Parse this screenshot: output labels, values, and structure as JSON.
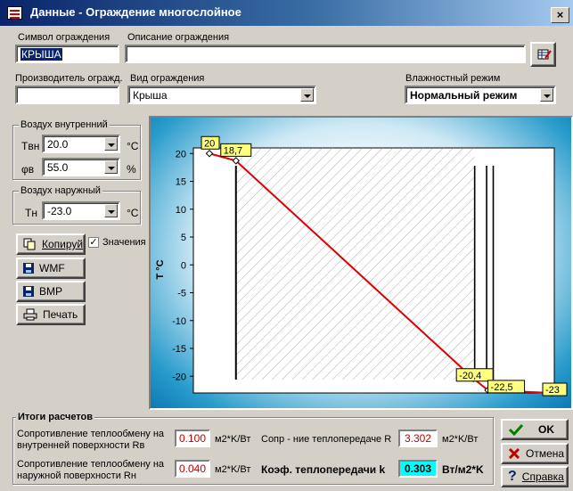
{
  "window": {
    "title": "Данные - Ограждение многослойное",
    "close_label": "×"
  },
  "form": {
    "symbol_label": "Символ ограждения",
    "symbol_value": "КРЫША",
    "description_label": "Описание ограждения",
    "description_value": "",
    "producer_label": "Производитель огражд.",
    "producer_value": "",
    "type_label": "Вид ограждения",
    "type_value": "Крыша",
    "humidity_label": "Влажностный режим",
    "humidity_value": "Нормальный режим"
  },
  "inner_air": {
    "title": "Воздух внутренний",
    "t_label": "Tвн",
    "t_value": "20.0",
    "t_unit": "°C",
    "phi_label": "φв",
    "phi_value": "55.0",
    "phi_unit": "%"
  },
  "outer_air": {
    "title": "Воздух наружный",
    "t_label": "Tн",
    "t_value": "-23.0",
    "t_unit": "°C"
  },
  "buttons": {
    "copy": "Копируй",
    "values_checkbox": "Значения",
    "values_checked": true,
    "wmf": "WMF",
    "bmp": "BMP",
    "print": "Печать"
  },
  "chart_data": {
    "type": "line",
    "ylabel": "T °C",
    "ylim": [
      -23,
      21
    ],
    "yticks": [
      20,
      15,
      10,
      5,
      0,
      -5,
      -10,
      -15,
      -20
    ],
    "x": [
      0,
      0.1,
      0.995,
      1.05,
      1.29
    ],
    "y": [
      20,
      18.7,
      -20.4,
      -22.5,
      -23
    ],
    "point_labels": [
      "20",
      "18,7",
      "-20,4",
      "-22,5",
      "-23"
    ],
    "line_color": "#e00000",
    "layer_boundaries": [
      0.1,
      1.0,
      1.045,
      1.07
    ]
  },
  "results": {
    "title": "Итоги расчетов",
    "rv_label": "Сопротивление теплообмену на внутренней поверхности Rв",
    "rv_value": "0.100",
    "rv_unit": "м2*K/Вт",
    "rn_label": "Сопротивление теплообмену на наружной поверхности Rн",
    "rn_value": "0.040",
    "rn_unit": "м2*K/Вт",
    "r_label": "Сопр - ние теплопередаче R",
    "r_value": "3.302",
    "r_unit": "м2*K/Вт",
    "k_label": "Коэф. теплопередачи k",
    "k_value": "0.303",
    "k_unit": "Вт/м2*K"
  },
  "dialog": {
    "ok": "OK",
    "cancel": "Отмена",
    "help": "Справка"
  }
}
